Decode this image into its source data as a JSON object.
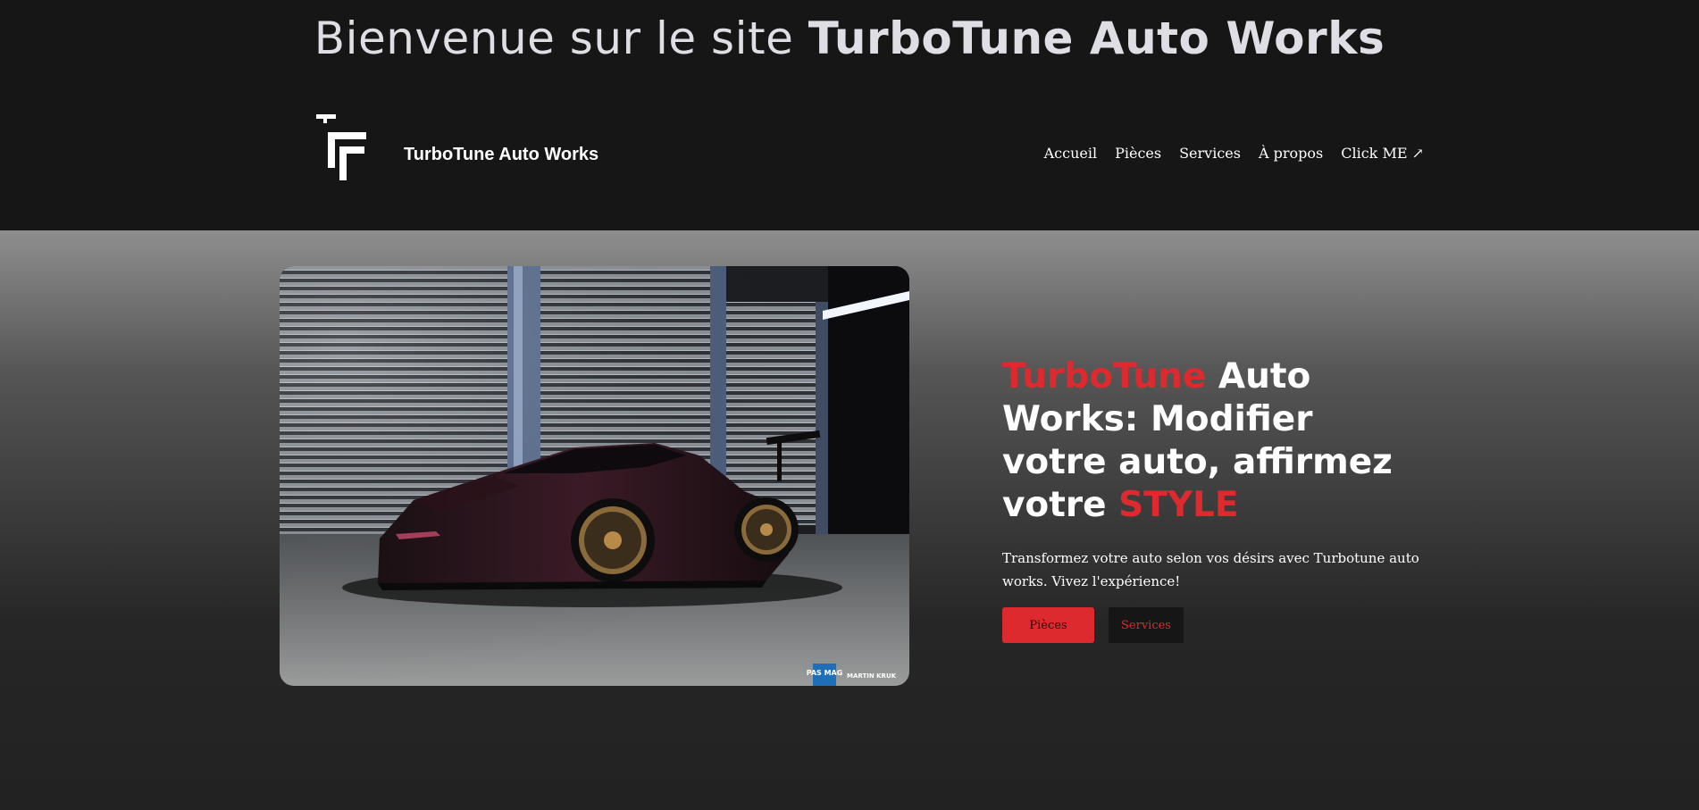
{
  "welcome": {
    "prefix": "Bienvenue sur le site ",
    "brand": "TurboTune Auto Works"
  },
  "header": {
    "logo_icon": "tt-monogram-logo",
    "brand_name": "TurboTune Auto Works",
    "nav": [
      {
        "label": "Accueil"
      },
      {
        "label": "Pièces"
      },
      {
        "label": "Services"
      },
      {
        "label": "À propos"
      },
      {
        "label": "Click ME ↗"
      }
    ]
  },
  "hero": {
    "image": {
      "subject": "car-in-garage-photo",
      "watermark_left": "PAS MAG",
      "watermark_right": "MARTIN KRUK"
    },
    "headline": {
      "part1_red": "TurboTune",
      "part2": " Auto Works: Modifier votre auto, affirmez votre ",
      "part3_red": "STYLE"
    },
    "tagline": "Transformez votre auto selon vos désirs avec Turbotune auto works. Vivez l'expérience!",
    "buttons": {
      "primary": "Pièces",
      "secondary": "Services"
    }
  },
  "colors": {
    "accent_red": "#dc2a2f",
    "header_bg": "#161616",
    "text_light": "#ffffff"
  }
}
